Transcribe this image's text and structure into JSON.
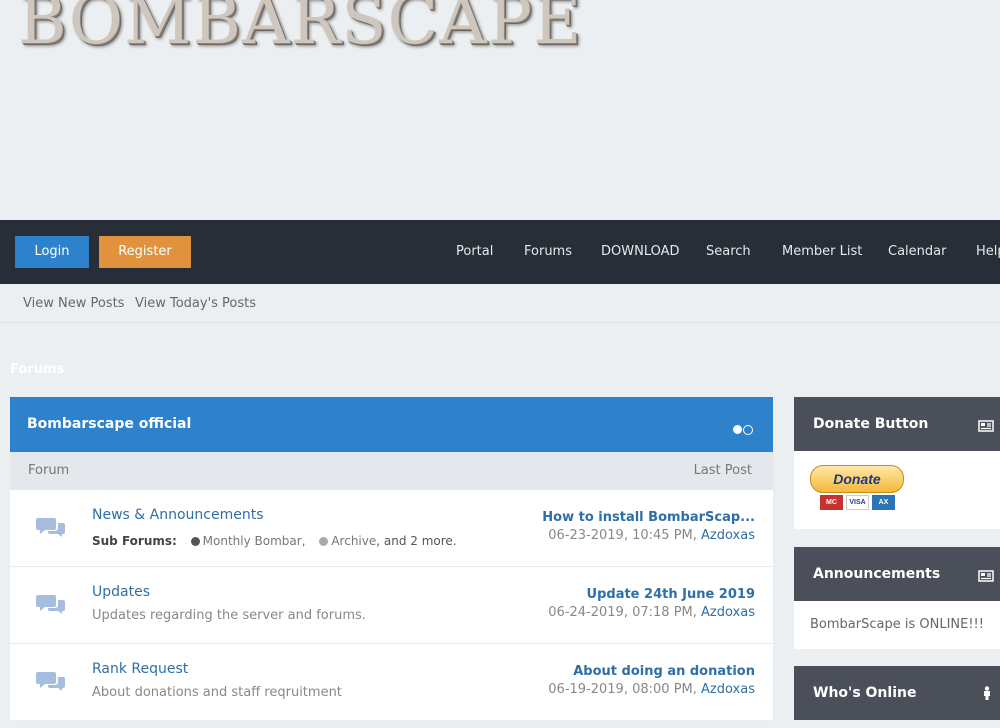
{
  "logo": {
    "text": "BOMBARSCAPE"
  },
  "navbar": {
    "login_label": "Login",
    "register_label": "Register",
    "links": [
      "Portal",
      "Forums",
      "DOWNLOAD",
      "Search",
      "Member List",
      "Calendar",
      "Help"
    ]
  },
  "subnav": {
    "new_posts": "View New Posts",
    "todays_posts": "View Today's Posts"
  },
  "breadcrumb": "Forums",
  "category": {
    "title": "Bombarscape official",
    "col_forum": "Forum",
    "col_last_post": "Last Post",
    "forums": [
      {
        "name": "News & Announcements",
        "subforums_label": "Sub Forums:",
        "subforums": [
          "Monthly Bombar",
          "Archive"
        ],
        "subforums_more": ", and 2 more.",
        "last_post_title": "How to install BombarScap...",
        "last_post_date": "06-23-2019, 10:45 PM,",
        "last_post_user": "Azdoxas"
      },
      {
        "name": "Updates",
        "description": "Updates regarding the server and forums.",
        "last_post_title": "Update 24th June 2019",
        "last_post_date": "06-24-2019, 07:18 PM,",
        "last_post_user": "Azdoxas"
      },
      {
        "name": "Rank Request",
        "description": "About donations and staff reqruitment",
        "last_post_title": "About doing an donation",
        "last_post_date": "06-19-2019, 08:00 PM,",
        "last_post_user": "Azdoxas"
      }
    ]
  },
  "sidebar": {
    "donate": {
      "title": "Donate Button",
      "button_label": "Donate",
      "icon": "newspaper-icon"
    },
    "announcements": {
      "title": "Announcements",
      "text": "BombarScape is ONLINE!!!",
      "icon": "newspaper-icon"
    },
    "whos_online": {
      "title": "Who's Online",
      "icon": "person-icon"
    }
  },
  "colors": {
    "navbar": "#282e38",
    "accent_blue": "#2e82cb",
    "register_orange": "#e0923c",
    "sidebar_header": "#4a4f5a",
    "link": "#2e6fa7"
  }
}
